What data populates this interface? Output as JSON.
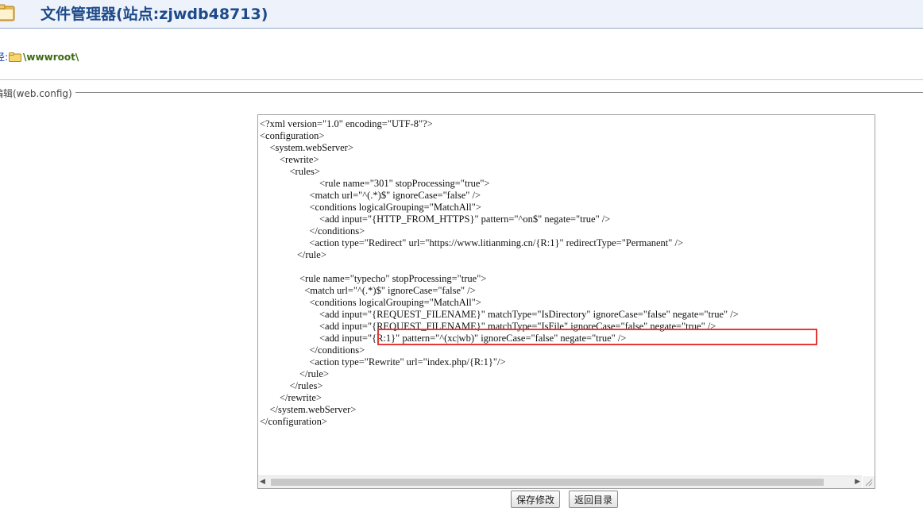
{
  "header": {
    "title": "文件管理器(站点:zjwdb48713)",
    "logo_icon": "folder-app-icon"
  },
  "path": {
    "label": "径:",
    "value": "\\wwwroot\\"
  },
  "section": {
    "legend": "编辑(web.config)"
  },
  "editor": {
    "lines": [
      "<?xml version=\"1.0\" encoding=\"UTF-8\"?>",
      "<configuration>",
      "    <system.webServer>",
      "        <rewrite>",
      "            <rules>",
      "                        <rule name=\"301\" stopProcessing=\"true\">",
      "                    <match url=\"^(.*)$\" ignoreCase=\"false\" />",
      "                    <conditions logicalGrouping=\"MatchAll\">",
      "                        <add input=\"{HTTP_FROM_HTTPS}\" pattern=\"^on$\" negate=\"true\" />",
      "                    </conditions>",
      "                    <action type=\"Redirect\" url=\"https://www.litianming.cn/{R:1}\" redirectType=\"Permanent\" />",
      "               </rule>",
      "",
      "                <rule name=\"typecho\" stopProcessing=\"true\">",
      "                  <match url=\"^(.*)$\" ignoreCase=\"false\" />",
      "                    <conditions logicalGrouping=\"MatchAll\">",
      "                        <add input=\"{REQUEST_FILENAME}\" matchType=\"IsDirectory\" ignoreCase=\"false\" negate=\"true\" />",
      "                        <add input=\"{REQUEST_FILENAME}\" matchType=\"IsFile\" ignoreCase=\"false\" negate=\"true\" />",
      "                        <add input=\"{R:1}\" pattern=\"^(xc|wb)\" ignoreCase=\"false\" negate=\"true\" />",
      "                    </conditions>",
      "                    <action type=\"Rewrite\" url=\"index.php/{R:1}\"/>",
      "                </rule>",
      "            </rules>",
      "        </rewrite>",
      "    </system.webServer>",
      "</configuration>"
    ]
  },
  "buttons": {
    "save_label": "保存修改",
    "back_label": "返回目录"
  },
  "colors": {
    "highlight": "#e53935",
    "title": "#1d4a8a",
    "header_bg": "#eef3fb"
  }
}
